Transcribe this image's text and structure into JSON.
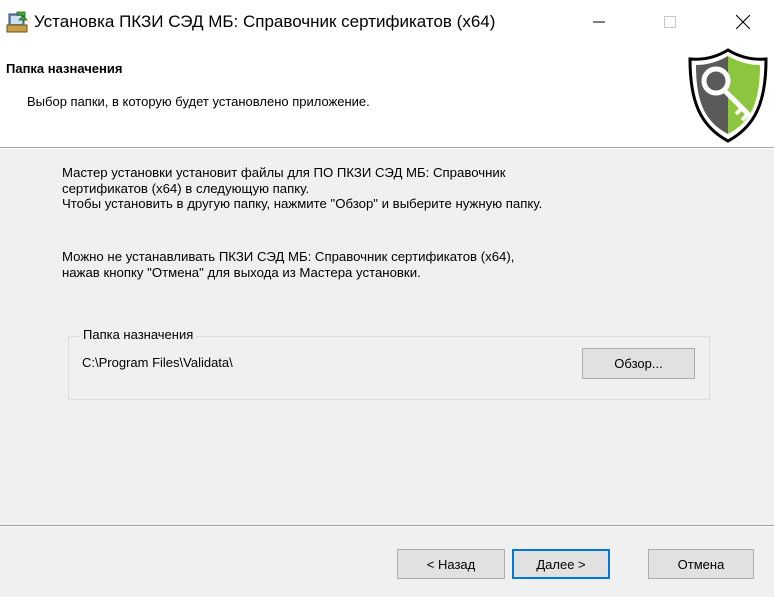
{
  "window": {
    "title": "Установка ПКЗИ СЭД МБ: Справочник сертификатов (x64)",
    "icon": "installer-icon"
  },
  "header": {
    "title": "Папка назначения",
    "subtitle": "Выбор папки, в которую будет установлено приложение.",
    "logo": "shield-key-logo"
  },
  "content": {
    "para1": [
      "Мастер установки установит файлы для ПО ПКЗИ СЭД МБ: Справочник",
      "сертификатов (x64) в следующую папку.",
      "Чтобы установить в другую папку, нажмите \"Обзор\" и выберите нужную папку."
    ],
    "para2": [
      "Можно не устанавливать ПКЗИ СЭД МБ: Справочник сертификатов (x64),",
      "нажав кнопку \"Отмена\" для выхода из Мастера установки."
    ]
  },
  "destination": {
    "group_label": "Папка назначения",
    "path": "C:\\Program Files\\Validata\\",
    "browse_label": "Обзор..."
  },
  "buttons": {
    "back": "< Назад",
    "next": "Далее >",
    "cancel": "Отмена"
  },
  "colors": {
    "accent": "#0078d7",
    "shield_green": "#8cc63f",
    "shield_gray": "#5a5a5a"
  }
}
